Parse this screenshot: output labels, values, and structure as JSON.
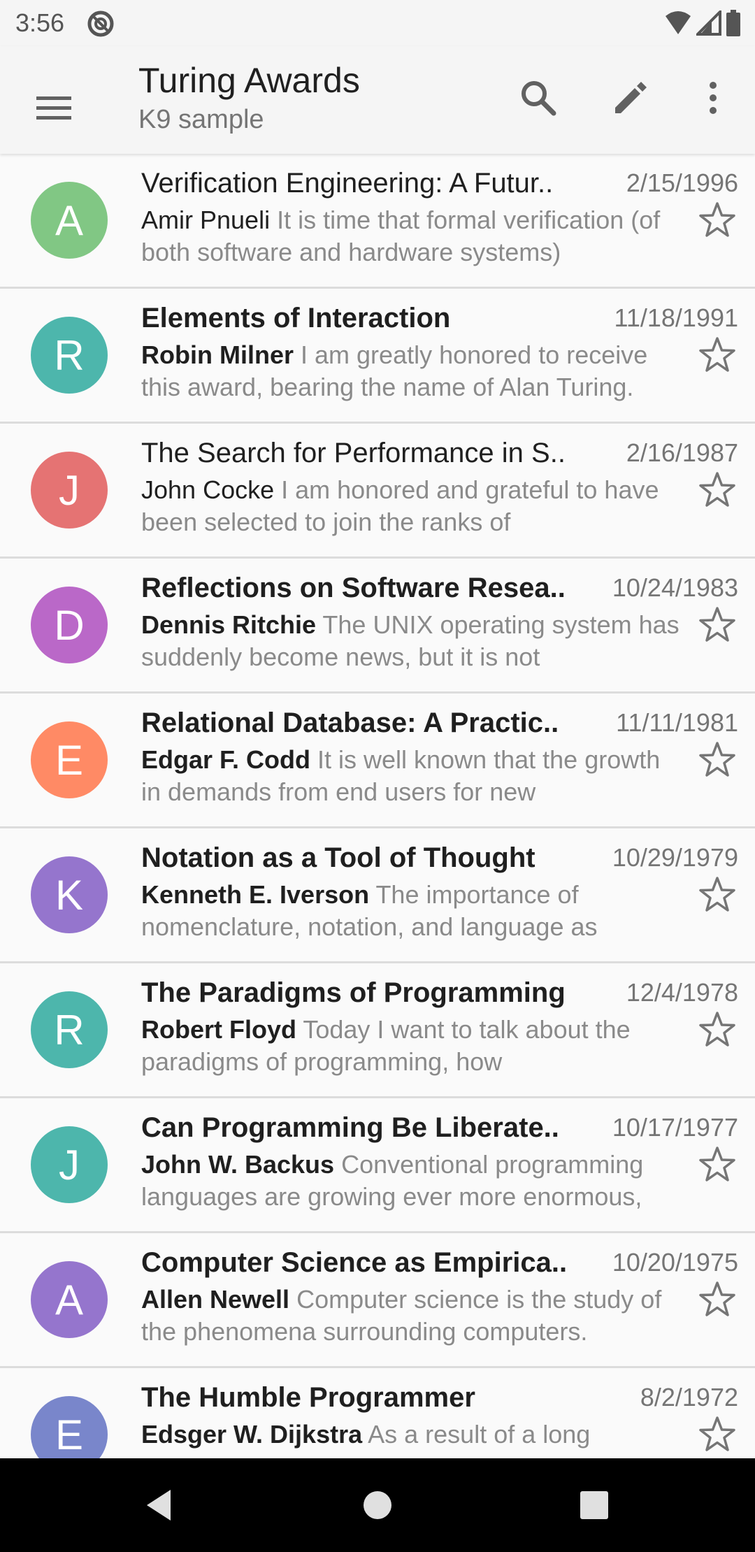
{
  "status": {
    "time": "3:56"
  },
  "app_bar": {
    "title": "Turing Awards",
    "subtitle": "K9 sample",
    "icons": [
      "menu-icon",
      "search-icon",
      "pencil-icon",
      "more-vert-icon"
    ]
  },
  "messages": [
    {
      "initial": "A",
      "color": "#81c784",
      "subject": "Verification Engineering: A Futur..",
      "date": "2/15/1996",
      "sender": "Amir Pnueli",
      "preview": "It is time that formal verification (of both software and hardware systems)",
      "unread": false
    },
    {
      "initial": "R",
      "color": "#4db6ac",
      "subject": "Elements of Interaction",
      "date": "11/18/1991",
      "sender": "Robin Milner",
      "preview": "I am greatly honored to receive this award, bearing the name of Alan Turing.",
      "unread": true
    },
    {
      "initial": "J",
      "color": "#e57373",
      "subject": "The Search for Performance in S..",
      "date": "2/16/1987",
      "sender": "John Cocke",
      "preview": "I am honored and grateful to have been selected to join the ranks of",
      "unread": false
    },
    {
      "initial": "D",
      "color": "#ba68c8",
      "subject": "Reflections on Software Resea..",
      "date": "10/24/1983",
      "sender": "Dennis Ritchie",
      "preview": "The UNIX operating system has suddenly become news, but it is not",
      "unread": true
    },
    {
      "initial": "E",
      "color": "#ff8a65",
      "subject": "Relational Database: A Practic..",
      "date": "11/11/1981",
      "sender": "Edgar F. Codd",
      "preview": "It is well known that the growth in demands from end users for new",
      "unread": true
    },
    {
      "initial": "K",
      "color": "#9575cd",
      "subject": "Notation as a Tool of Thought",
      "date": "10/29/1979",
      "sender": "Kenneth E. Iverson",
      "preview": "The importance of nomenclature, notation, and language as",
      "unread": true
    },
    {
      "initial": "R",
      "color": "#4db6ac",
      "subject": "The Paradigms of Programming",
      "date": "12/4/1978",
      "sender": "Robert Floyd",
      "preview": "Today I want to talk about the paradigms of programming, how",
      "unread": true
    },
    {
      "initial": "J",
      "color": "#4db6ac",
      "subject": "Can Programming Be Liberate..",
      "date": "10/17/1977",
      "sender": "John W. Backus",
      "preview": "Conventional programming languages are growing ever more enormous,",
      "unread": true
    },
    {
      "initial": "A",
      "color": "#9575cd",
      "subject": "Computer Science as Empirica..",
      "date": "10/20/1975",
      "sender": "Allen Newell",
      "preview": "Computer science is the study of the phenomena surrounding computers.",
      "unread": true
    },
    {
      "initial": "E",
      "color": "#7986cb",
      "subject": "The Humble Programmer",
      "date": "8/2/1972",
      "sender": "Edsger W. Dijkstra",
      "preview": "As a result of a long",
      "unread": true
    }
  ]
}
